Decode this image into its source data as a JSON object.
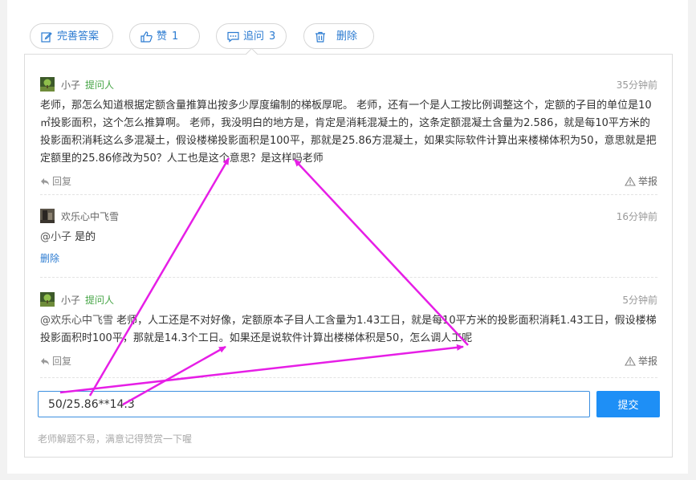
{
  "actions": [
    {
      "label": "完善答案",
      "count": ""
    },
    {
      "label": "赞",
      "count": "1"
    },
    {
      "label": "追问",
      "count": "3"
    },
    {
      "label": "删除",
      "count": ""
    }
  ],
  "comments": [
    {
      "user": "小子",
      "tag": "提问人",
      "time": "35分钟前",
      "mention": "",
      "text": "老师，那怎么知道根据定额含量推算出按多少厚度编制的梯板厚呢。 老师，还有一个是人工按比例调整这个，定额的子目的单位是10㎡投影面积，这个怎么推算啊。 老师，我没明白的地方是，肯定是消耗混凝土的，这条定额混凝土含量为2.586，就是每10平方米的投影面积消耗这么多混凝土，假设楼梯投影面积是100平，那就是25.86方混凝土，如果实际软件计算出来楼梯体积为50，意思就是把定额里的25.86修改为50？人工也是这个意思？是这样吗老师",
      "reply_label": "回复",
      "report_label": "举报"
    },
    {
      "user": "欢乐心中飞雪",
      "tag": "",
      "time": "16分钟前",
      "mention": "@小子",
      "text": " 是的",
      "delete_label": "删除"
    },
    {
      "user": "小子",
      "tag": "提问人",
      "time": "5分钟前",
      "mention": "@欢乐心中飞雪",
      "text": " 老师，人工还是不对好像，定额原本子目人工含量为1.43工日，就是每10平方米的投影面积消耗1.43工日，假设楼梯投影面积时100平，那就是14.3个工日。如果还是说软件计算出楼梯体积是50，怎么调人工呢",
      "reply_label": "回复",
      "report_label": "举报"
    }
  ],
  "reply_box": {
    "value": "50/25.86**14.3",
    "submit_label": "提交"
  },
  "tip": "老师解题不易，满意记得赞赏一下喔",
  "colors": {
    "link_blue": "#2b7bd1",
    "tag_green": "#46a546",
    "submit_blue": "#1e8ff6",
    "annotation_magenta": "#e61ee6"
  }
}
